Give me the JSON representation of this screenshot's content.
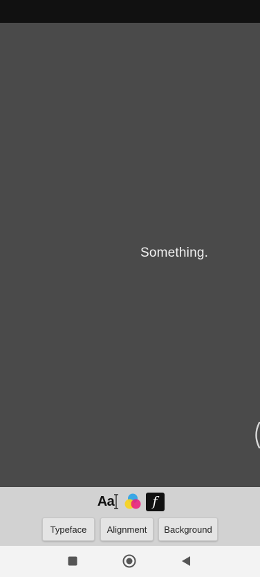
{
  "canvas": {
    "text": "Something.",
    "background_color": "#4a4a4a",
    "text_color": "#f2f2f2"
  },
  "edge_handle": {
    "icon": "panel-handle-icon"
  },
  "tool_panel": {
    "mode_icons": [
      {
        "name": "text-format-icon",
        "glyph": "Aa"
      },
      {
        "name": "color-palette-icon"
      },
      {
        "name": "font-icon",
        "glyph": "f"
      }
    ],
    "tabs": [
      {
        "label": "Typeface"
      },
      {
        "label": "Alignment"
      },
      {
        "label": "Background"
      }
    ]
  },
  "nav_bar": {
    "buttons": [
      {
        "name": "recents-icon"
      },
      {
        "name": "home-icon"
      },
      {
        "name": "back-icon"
      }
    ]
  }
}
